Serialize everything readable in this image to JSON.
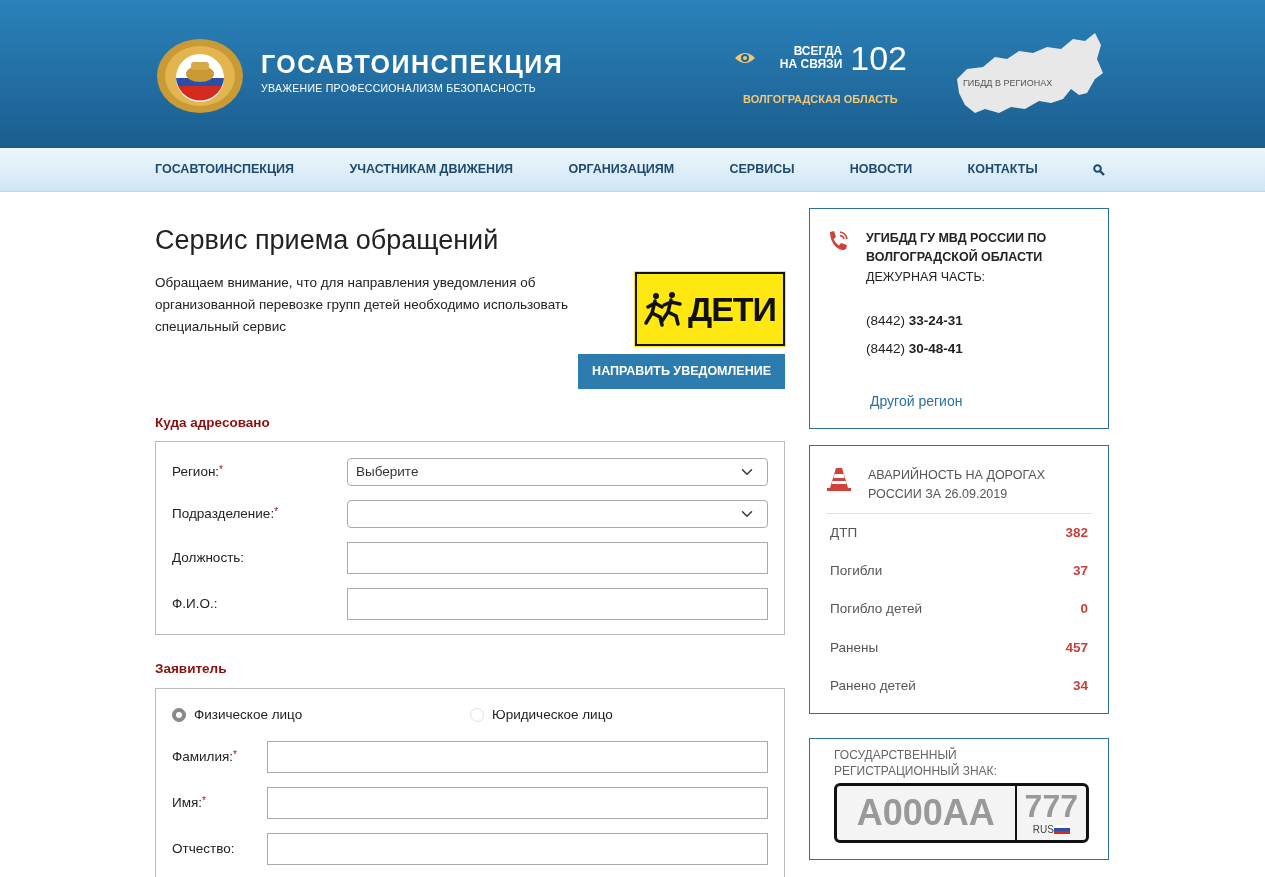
{
  "header": {
    "title": "ГОСАВТОИНСПЕКЦИЯ",
    "subtitle": "УВАЖЕНИЕ ПРОФЕССИОНАЛИЗМ БЕЗОПАСНОСТЬ",
    "hotline_line1": "ВСЕГДА",
    "hotline_line2": "НА СВЯЗИ",
    "hotline_number": "102",
    "region": "ВОЛГОГРАДСКАЯ ОБЛАСТЬ",
    "map_label": "ГИБДД В РЕГИОНАХ"
  },
  "nav": {
    "items": [
      "ГОСАВТОИНСПЕКЦИЯ",
      "УЧАСТНИКАМ ДВИЖЕНИЯ",
      "ОРГАНИЗАЦИЯМ",
      "СЕРВИСЫ",
      "НОВОСТИ",
      "КОНТАКТЫ"
    ]
  },
  "page": {
    "title": "Сервис приема обращений",
    "notice": "Обращаем внимание, что для направления уведомления об организованной перевозке групп детей необходимо использовать специальный сервис",
    "banner_text": "ДЕТИ",
    "button": "НАПРАВИТЬ УВЕДОМЛЕНИЕ"
  },
  "sections": [
    {
      "heading": "Куда адресовано",
      "fields": [
        {
          "kind": "select",
          "label": "Регион:",
          "required_mark": "*",
          "value": "Выберите"
        },
        {
          "kind": "select",
          "label": "Подразделение:",
          "required_mark": "*"
        },
        {
          "kind": "text",
          "label": "Должность:"
        },
        {
          "kind": "text",
          "label": "Ф.И.О.:"
        }
      ]
    },
    {
      "heading": "Заявитель",
      "radios": [
        {
          "label": "Физическое лицо",
          "selected": true
        },
        {
          "label": "Юридическое лицо",
          "selected": false
        }
      ],
      "fields": [
        {
          "kind": "text",
          "label": "Фамилия:",
          "required_mark": "*"
        },
        {
          "kind": "text",
          "label": "Имя:",
          "required_mark": "*"
        },
        {
          "kind": "text",
          "label": "Отчество:"
        }
      ]
    }
  ],
  "sidebar": {
    "contact": {
      "title": "УГИБДД ГУ МВД РОССИИ ПО ВОЛГОГРАДСКОЙ ОБЛАСТИ",
      "subtitle": "ДЕЖУРНАЯ ЧАСТЬ:",
      "phones": [
        {
          "code": "(8442)",
          "number": "33-24-31"
        },
        {
          "code": "(8442)",
          "number": "30-48-41"
        }
      ],
      "link": "Другой регион"
    },
    "stats": {
      "title": "АВАРИЙНОСТЬ НА ДОРОГАХ РОССИИ ЗА 26.09.2019",
      "rows": [
        {
          "label": "ДТП",
          "value": "382"
        },
        {
          "label": "Погибли",
          "value": "37"
        },
        {
          "label": "Погибло детей",
          "value": "0"
        },
        {
          "label": "Ранены",
          "value": "457"
        },
        {
          "label": "Ранено детей",
          "value": "34"
        }
      ]
    },
    "plate": {
      "label": "ГОСУДАРСТВЕННЫЙ РЕГИСТРАЦИОННЫЙ ЗНАК:",
      "number": "А000АА",
      "region": "777",
      "country": "RUS"
    }
  }
}
